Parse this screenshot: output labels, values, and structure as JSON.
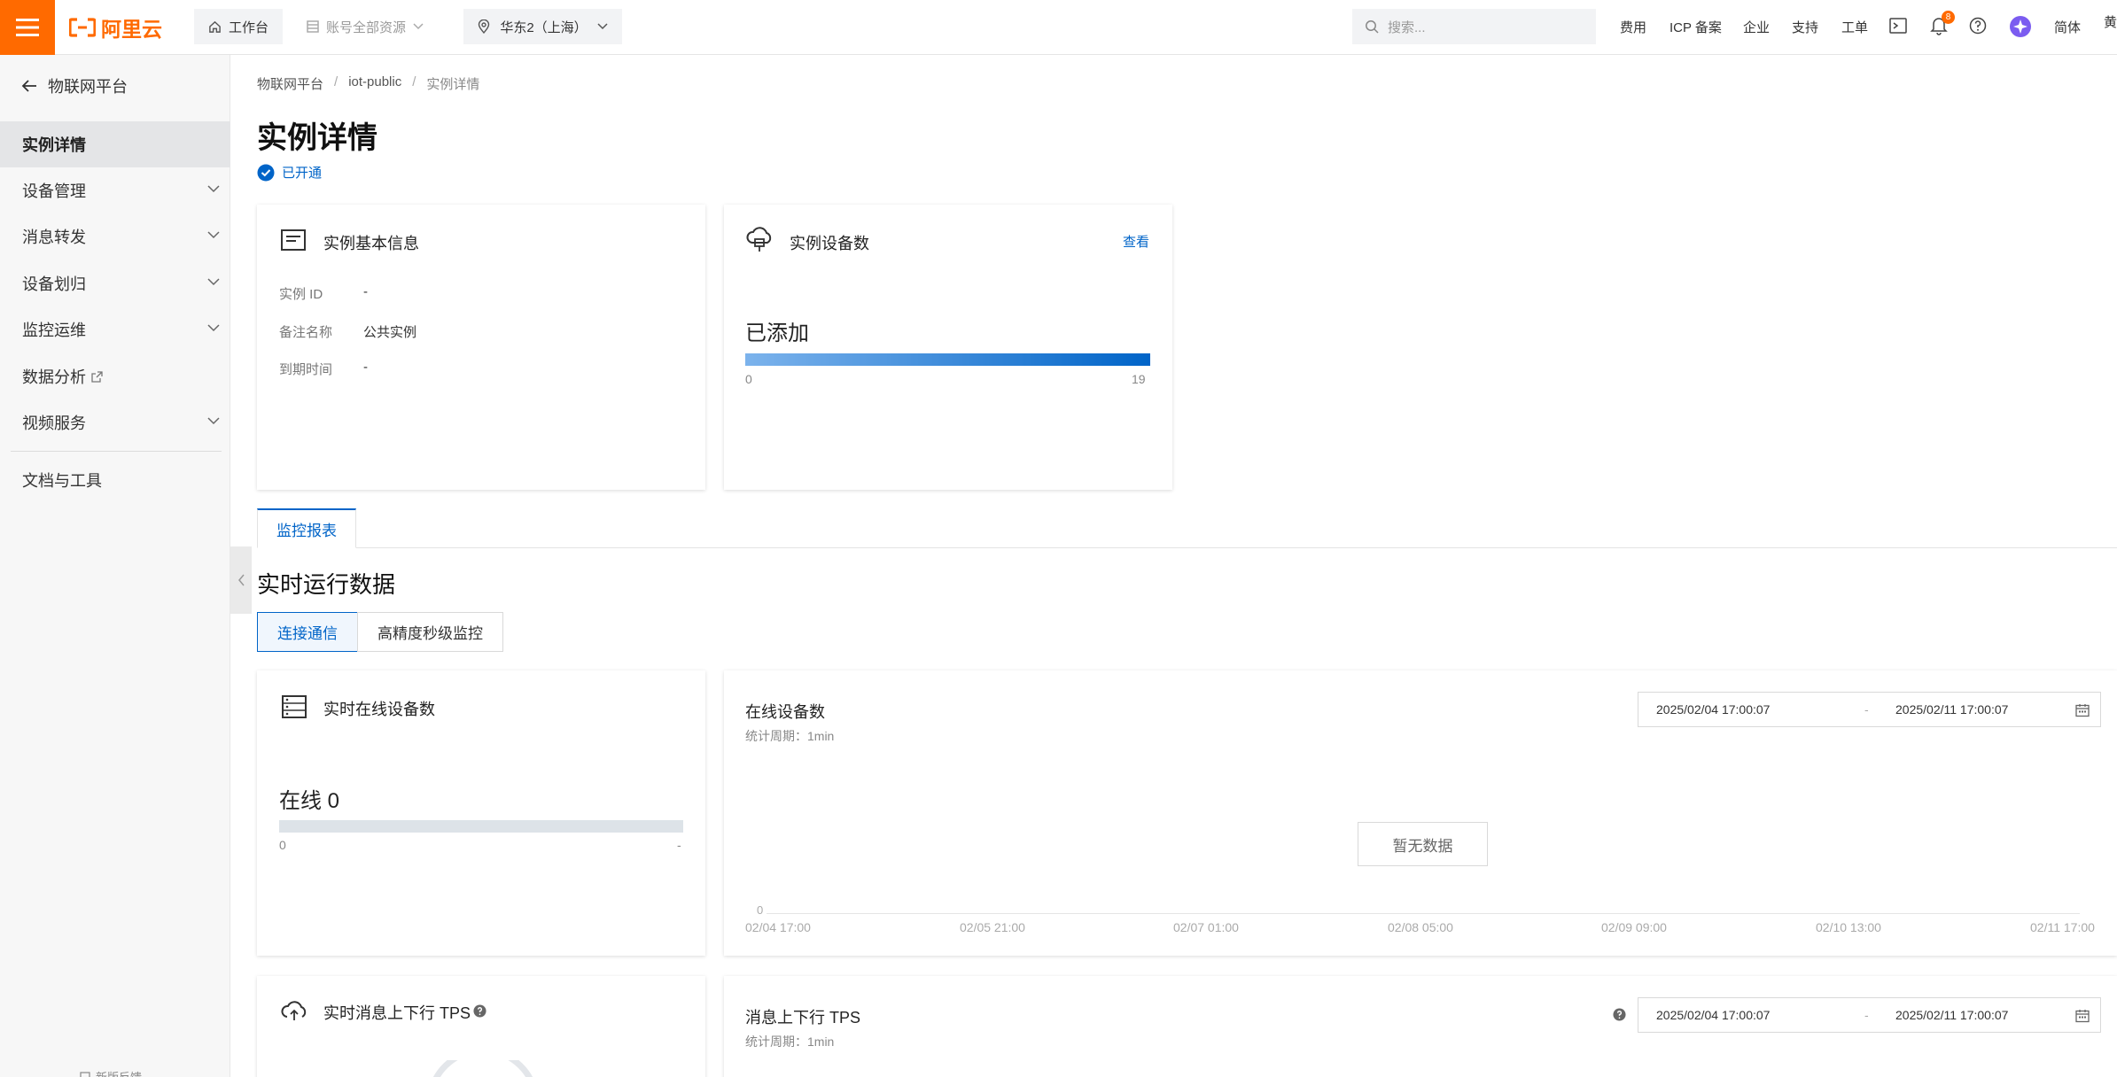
{
  "header": {
    "brand": "阿里云",
    "workbench": "工作台",
    "account_scope": "账号全部资源",
    "region": "华东2（上海）",
    "search_placeholder": "搜索...",
    "links": [
      "费用",
      "ICP 备案",
      "企业",
      "支持",
      "工单"
    ],
    "notification_count": "8",
    "language": "简体",
    "cut_off_text": "黄"
  },
  "sidebar": {
    "back_label": "物联网平台",
    "items": [
      {
        "label": "实例详情",
        "active": true
      },
      {
        "label": "设备管理",
        "expandable": true
      },
      {
        "label": "消息转发",
        "expandable": true
      },
      {
        "label": "设备划归",
        "expandable": true
      },
      {
        "label": "监控运维",
        "expandable": true
      },
      {
        "label": "数据分析",
        "external": true
      },
      {
        "label": "视频服务",
        "expandable": true
      }
    ],
    "docs_label": "文档与工具",
    "footer_label": "新版反馈"
  },
  "breadcrumb": [
    "物联网平台",
    "iot-public",
    "实例详情"
  ],
  "page": {
    "title": "实例详情",
    "status": "已开通"
  },
  "basic_info": {
    "title": "实例基本信息",
    "fields": [
      {
        "key": "实例 ID",
        "value": "-"
      },
      {
        "key": "备注名称",
        "value": "公共实例"
      },
      {
        "key": "到期时间",
        "value": "-"
      }
    ]
  },
  "device_count": {
    "title": "实例设备数",
    "view_link": "查看",
    "headline": "已添加",
    "min": "0",
    "max": "19",
    "fill_fraction": 1.0
  },
  "tabs": [
    "监控报表"
  ],
  "realtime": {
    "section_title": "实时运行数据",
    "segments": [
      "连接通信",
      "高精度秒级监控"
    ],
    "online_card": {
      "title": "实时在线设备数",
      "headline": "在线 0",
      "min": "0",
      "max": "-",
      "fill_fraction": 0
    },
    "online_chart": {
      "title": "在线设备数",
      "period": "统计周期：1min",
      "start": "2025/02/04 17:00:07",
      "separator": "-",
      "end": "2025/02/11 17:00:07",
      "empty": "暂无数据",
      "y_zero": "0",
      "x_ticks": [
        "02/04 17:00",
        "02/05 21:00",
        "02/07 01:00",
        "02/08 05:00",
        "02/09 09:00",
        "02/10 13:00",
        "02/11 17:00"
      ]
    },
    "tps_card": {
      "title": "实时消息上下行 TPS"
    },
    "tps_chart": {
      "title": "消息上下行 TPS",
      "period": "统计周期：1min",
      "start": "2025/02/04 17:00:07",
      "separator": "-",
      "end": "2025/02/11 17:00:07"
    }
  },
  "colors": {
    "brand_orange": "#ff6a00",
    "primary_blue": "#0064c8"
  }
}
